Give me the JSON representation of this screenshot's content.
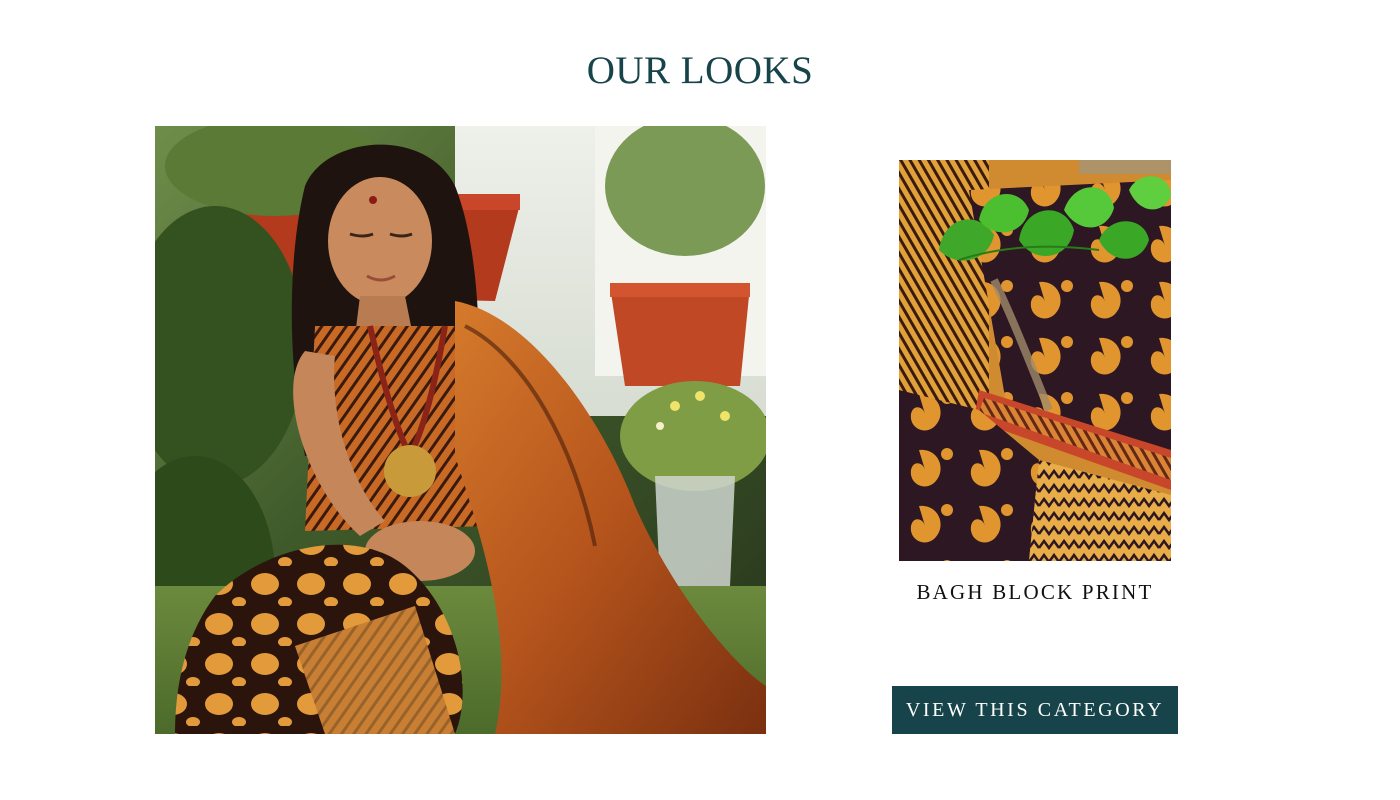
{
  "section": {
    "title": "OUR LOOKS"
  },
  "hero_image": {
    "subject": "woman seated in garden wearing orange and black block print outfit"
  },
  "product": {
    "image_subject": "folded bagh block print fabric with leaves",
    "caption": "BAGH BLOCK PRINT",
    "cta_label": "VIEW THIS CATEGORY"
  },
  "colors": {
    "accent": "#17444a",
    "caption_text": "#111111",
    "background": "#ffffff"
  }
}
